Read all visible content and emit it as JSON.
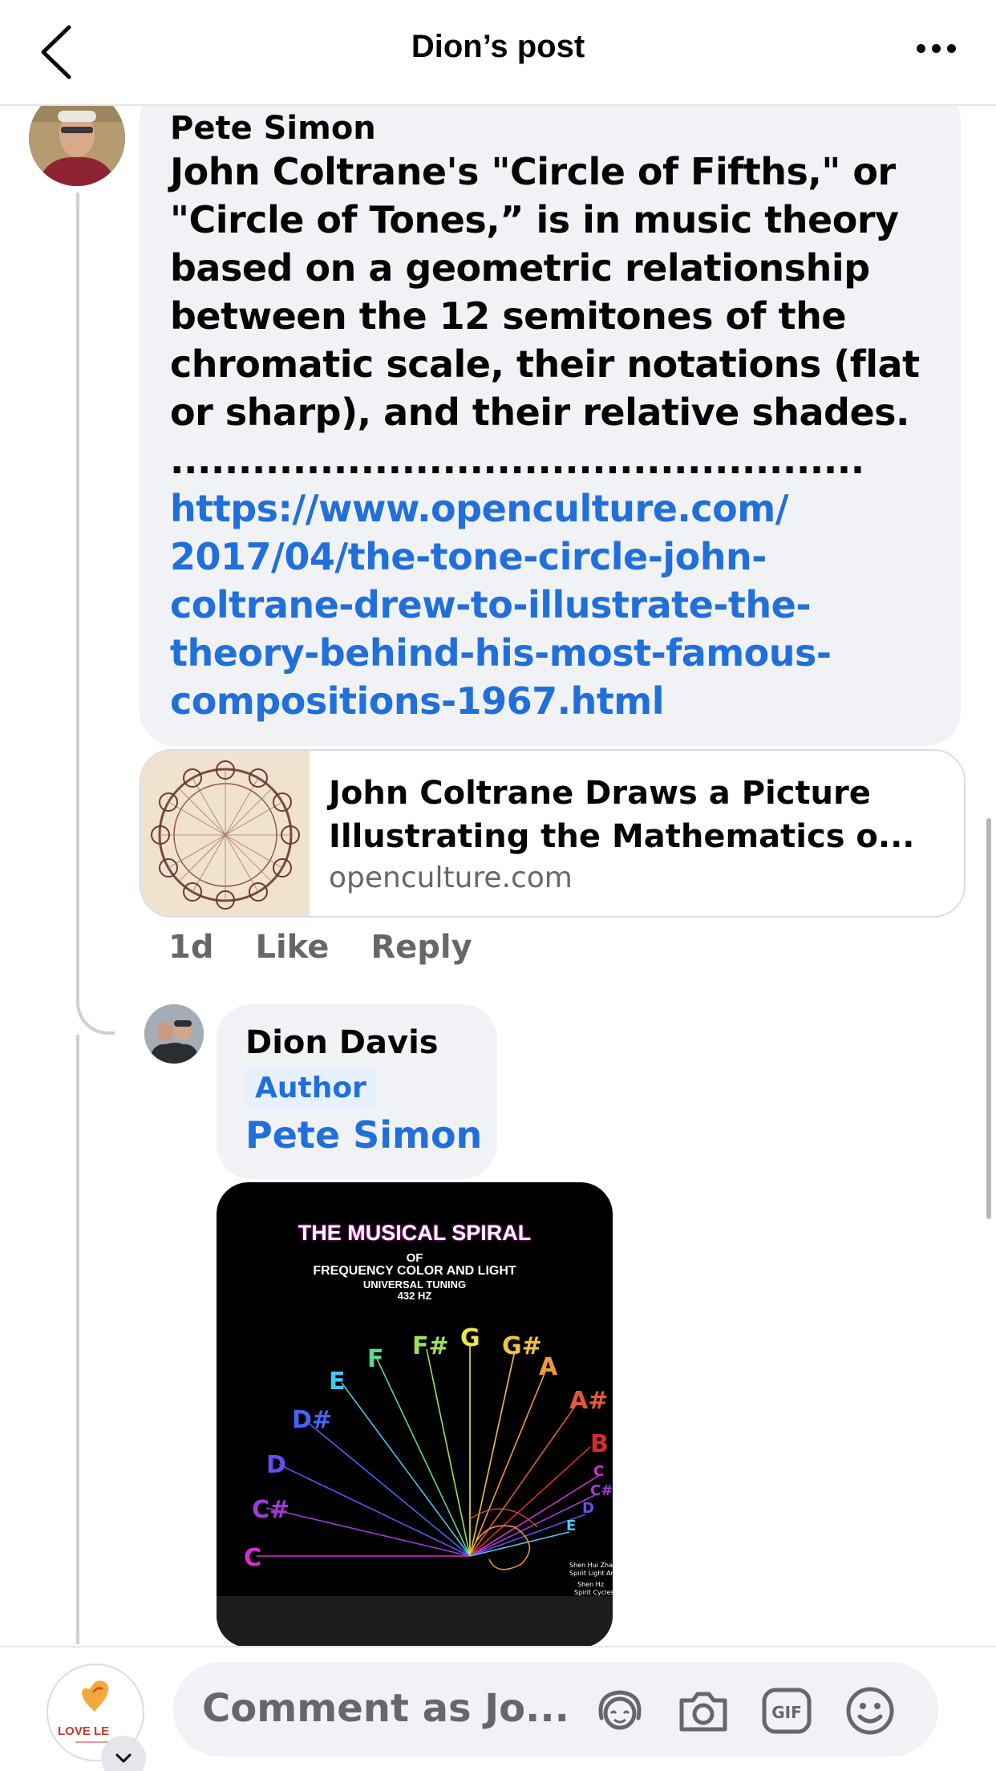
{
  "header": {
    "title": "Dion’s post"
  },
  "comment": {
    "author": "Pete Simon",
    "text": "John Coltrane's \"Circle of Fifths,\" or \"Circle of Tones,” is in music theory based on a geometric relationship between the 12 semitones of the chromatic scale, their notations (flat or sharp), and their relative shades. ................................................... ",
    "link": "https://www.openculture.com/2017/04/the-tone-circle-john-coltrane-drew-to-illustrate-the-theory-behind-his-most-famous-compositions-1967.html",
    "link_display": "https://www.openculture.com/ 2017/04/the-tone-circle-john- coltrane-drew-to-illustrate-the- theory-behind-his-most-famous- compositions-1967.html",
    "preview": {
      "title": "John Coltrane Draws a Picture Illustrating the Mathematics o...",
      "domain": "openculture.com"
    },
    "time": "1d",
    "like_label": "Like",
    "reply_label": "Reply"
  },
  "reply": {
    "author": "Dion Davis",
    "badge": "Author",
    "mention": "Pete Simon",
    "image": {
      "title": "THE MUSICAL SPIRAL",
      "line1": "OF",
      "line2": "FREQUENCY COLOR AND LIGHT",
      "line3": "UNIVERSAL TUNING",
      "line4": "432 HZ",
      "notes": [
        "C",
        "C#",
        "D",
        "D#",
        "E",
        "F",
        "F#",
        "G",
        "G#",
        "A",
        "A#",
        "B",
        "C",
        "C#",
        "D",
        "E"
      ]
    }
  },
  "composer": {
    "placeholder": "Comment as Jo...",
    "avatar_text": "LOVE LE"
  },
  "icons": [
    "back-icon",
    "more-icon",
    "avatar-sticker-icon",
    "camera-icon",
    "gif-icon",
    "emoji-icon",
    "chevron-down-icon"
  ]
}
